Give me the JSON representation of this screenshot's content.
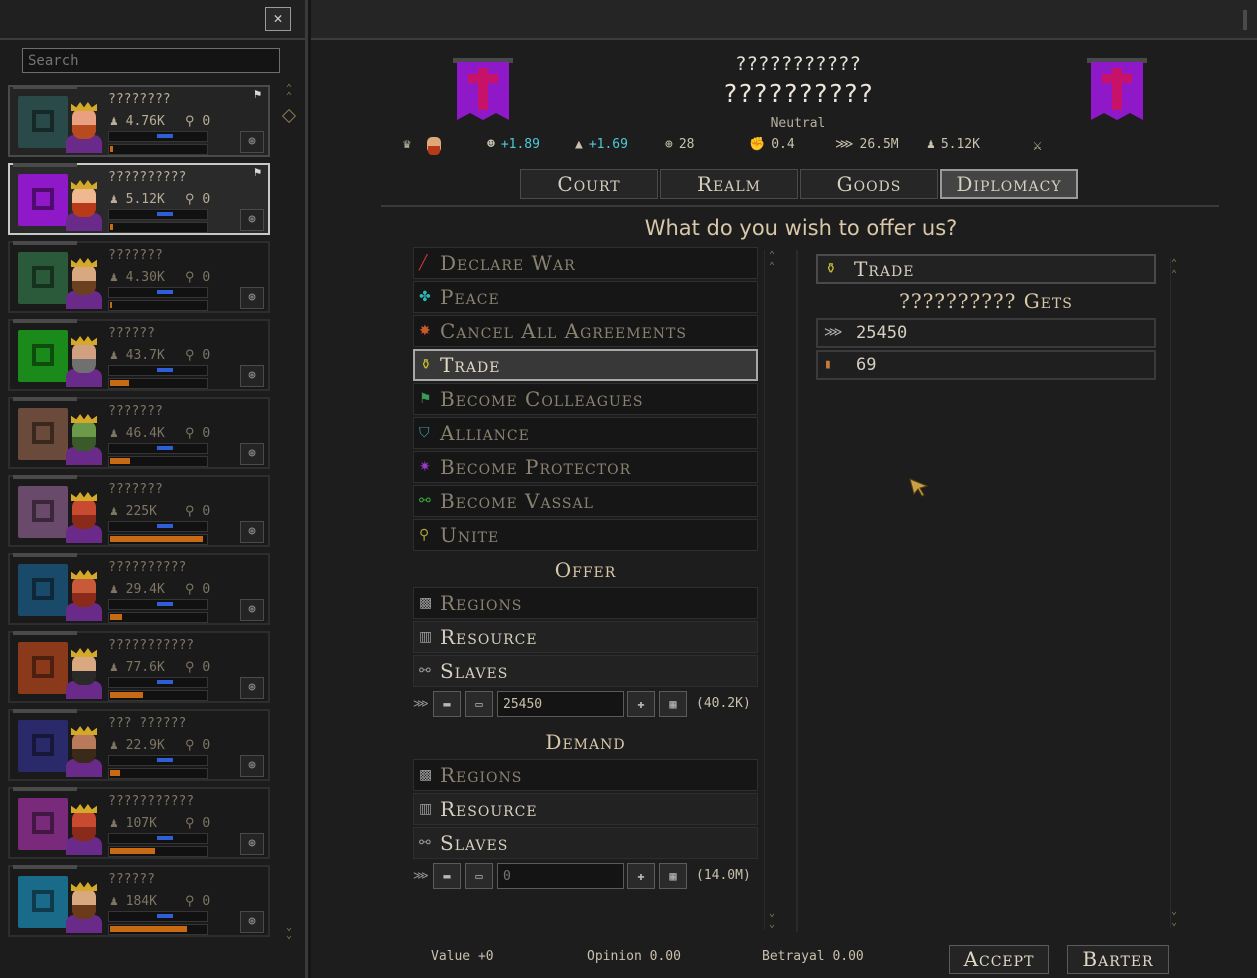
{
  "left": {
    "close_glyph": "✕",
    "search": {
      "placeholder": "Search",
      "value": ""
    },
    "realms": [
      {
        "name": "????????",
        "pop": "4.76K",
        "mil": "0",
        "crest": "#2a4a4a",
        "skin": "#e8a080",
        "beard": "#b84a20",
        "flag": true,
        "pop_level": 0.03
      },
      {
        "name": "??????????",
        "pop": "5.12K",
        "mil": "0",
        "crest": "#8f19c8",
        "skin": "#f0b890",
        "beard": "#b83a18",
        "flag": true,
        "pop_level": 0.03
      },
      {
        "name": "???????",
        "pop": "4.30K",
        "mil": "0",
        "crest": "#2a5a3a",
        "skin": "#d8a880",
        "beard": "#6a4020",
        "flag": false,
        "pop_level": 0.02
      },
      {
        "name": "??????",
        "pop": "43.7K",
        "mil": "0",
        "crest": "#1a8a1a",
        "skin": "#d0a080",
        "beard": "#707070",
        "flag": false,
        "pop_level": 0.2
      },
      {
        "name": "???????",
        "pop": "46.4K",
        "mil": "0",
        "crest": "#6a4a3a",
        "skin": "#6a9a4a",
        "beard": "#3a5a2a",
        "flag": false,
        "pop_level": 0.21
      },
      {
        "name": "???????",
        "pop": "225K",
        "mil": "0",
        "crest": "#6a4a6a",
        "skin": "#c84a30",
        "beard": "#8a2a1a",
        "flag": false,
        "pop_level": 0.97
      },
      {
        "name": "??????????",
        "pop": "29.4K",
        "mil": "0",
        "crest": "#1a4a6a",
        "skin": "#c85a3a",
        "beard": "#8a2a1a",
        "flag": false,
        "pop_level": 0.13
      },
      {
        "name": "???????????",
        "pop": "77.6K",
        "mil": "0",
        "crest": "#8a3a1a",
        "skin": "#d8a880",
        "beard": "#2a2a2a",
        "flag": false,
        "pop_level": 0.34
      },
      {
        "name": "??? ??????",
        "pop": "22.9K",
        "mil": "0",
        "crest": "#2a2a6a",
        "skin": "#b87a5a",
        "beard": "#3a2a1a",
        "flag": false,
        "pop_level": 0.1
      },
      {
        "name": "???????????",
        "pop": "107K",
        "mil": "0",
        "crest": "#7a2a7a",
        "skin": "#c84a30",
        "beard": "#8a2a1a",
        "flag": false,
        "pop_level": 0.47
      },
      {
        "name": "??????",
        "pop": "184K",
        "mil": "0",
        "crest": "#1a6a8a",
        "skin": "#d8a880",
        "beard": "#6a3a1a",
        "flag": false,
        "pop_level": 0.8
      }
    ]
  },
  "header": {
    "sub_title": "???????????",
    "title": "??????????",
    "relation": "Neutral"
  },
  "stats": [
    {
      "icon": "face-icon",
      "glyph": "☻",
      "value": "+1.89",
      "cyan": true
    },
    {
      "icon": "warning-icon",
      "glyph": "▲",
      "value": "+1.69",
      "cyan": true
    },
    {
      "icon": "target-icon",
      "glyph": "⊕",
      "value": "28",
      "cyan": false
    },
    {
      "icon": "fist-icon",
      "glyph": "✊",
      "value": "0.4",
      "cyan": false
    },
    {
      "icon": "coins-icon",
      "glyph": "⋙",
      "value": "26.5M",
      "cyan": false
    },
    {
      "icon": "person-icon",
      "glyph": "♟",
      "value": "5.12K",
      "cyan": false
    }
  ],
  "tabs": [
    "Court",
    "Realm",
    "Goods",
    "Diplomacy"
  ],
  "active_tab": "Diplomacy",
  "question": "What do you wish to offer us?",
  "options": [
    {
      "label": "Declare War",
      "icon": "sword-icon",
      "glyph": "╱",
      "color": "#c83a3a"
    },
    {
      "label": "Peace",
      "icon": "dove-icon",
      "glyph": "✤",
      "color": "#2ab8b8"
    },
    {
      "label": "Cancel All Agreements",
      "icon": "cancel-icon",
      "glyph": "✸",
      "color": "#c8582a"
    },
    {
      "label": "Trade",
      "icon": "amphora-icon",
      "glyph": "⚱",
      "color": "#c8c030",
      "selected": true
    },
    {
      "label": "Become Colleagues",
      "icon": "flag-icon",
      "glyph": "⚑",
      "color": "#3a9a5a"
    },
    {
      "label": "Alliance",
      "icon": "shield-icon",
      "glyph": "⛉",
      "color": "#3a9aa8"
    },
    {
      "label": "Become Protector",
      "icon": "claw-icon",
      "glyph": "✷",
      "color": "#9a3ac8"
    },
    {
      "label": "Become Vassal",
      "icon": "chain-icon",
      "glyph": "⚯",
      "color": "#3aa83a"
    },
    {
      "label": "Unite",
      "icon": "banner-icon",
      "glyph": "⚲",
      "color": "#a8a03a"
    }
  ],
  "offer": {
    "heading": "Offer",
    "items": [
      {
        "label": "Regions",
        "glyph": "▩",
        "lit": false
      },
      {
        "label": "Resource",
        "glyph": "▥",
        "lit": true
      },
      {
        "label": "Slaves",
        "glyph": "⚯",
        "lit": true
      }
    ],
    "coin_glyph": "⋙",
    "value": "25450",
    "placeholder": "",
    "max": "(40.2K)"
  },
  "demand": {
    "heading": "Demand",
    "items": [
      {
        "label": "Regions",
        "glyph": "▩",
        "lit": false
      },
      {
        "label": "Resource",
        "glyph": "▥",
        "lit": true
      },
      {
        "label": "Slaves",
        "glyph": "⚯",
        "lit": true
      }
    ],
    "coin_glyph": "⋙",
    "value": "",
    "placeholder": "0",
    "max": "(14.0M)"
  },
  "right": {
    "header": "Trade",
    "gets": "?????????? Gets",
    "items": [
      {
        "value": "25450",
        "icon": "coins-icon",
        "glyph": "⋙",
        "color": "#b0b0b0"
      },
      {
        "value": "69",
        "icon": "wood-icon",
        "glyph": "▮",
        "color": "#c87a3a"
      }
    ]
  },
  "footer": {
    "value": "Value +0",
    "opinion": "Opinion 0.00",
    "betrayal": "Betrayal 0.00",
    "accept": "Accept",
    "barter": "Barter"
  }
}
